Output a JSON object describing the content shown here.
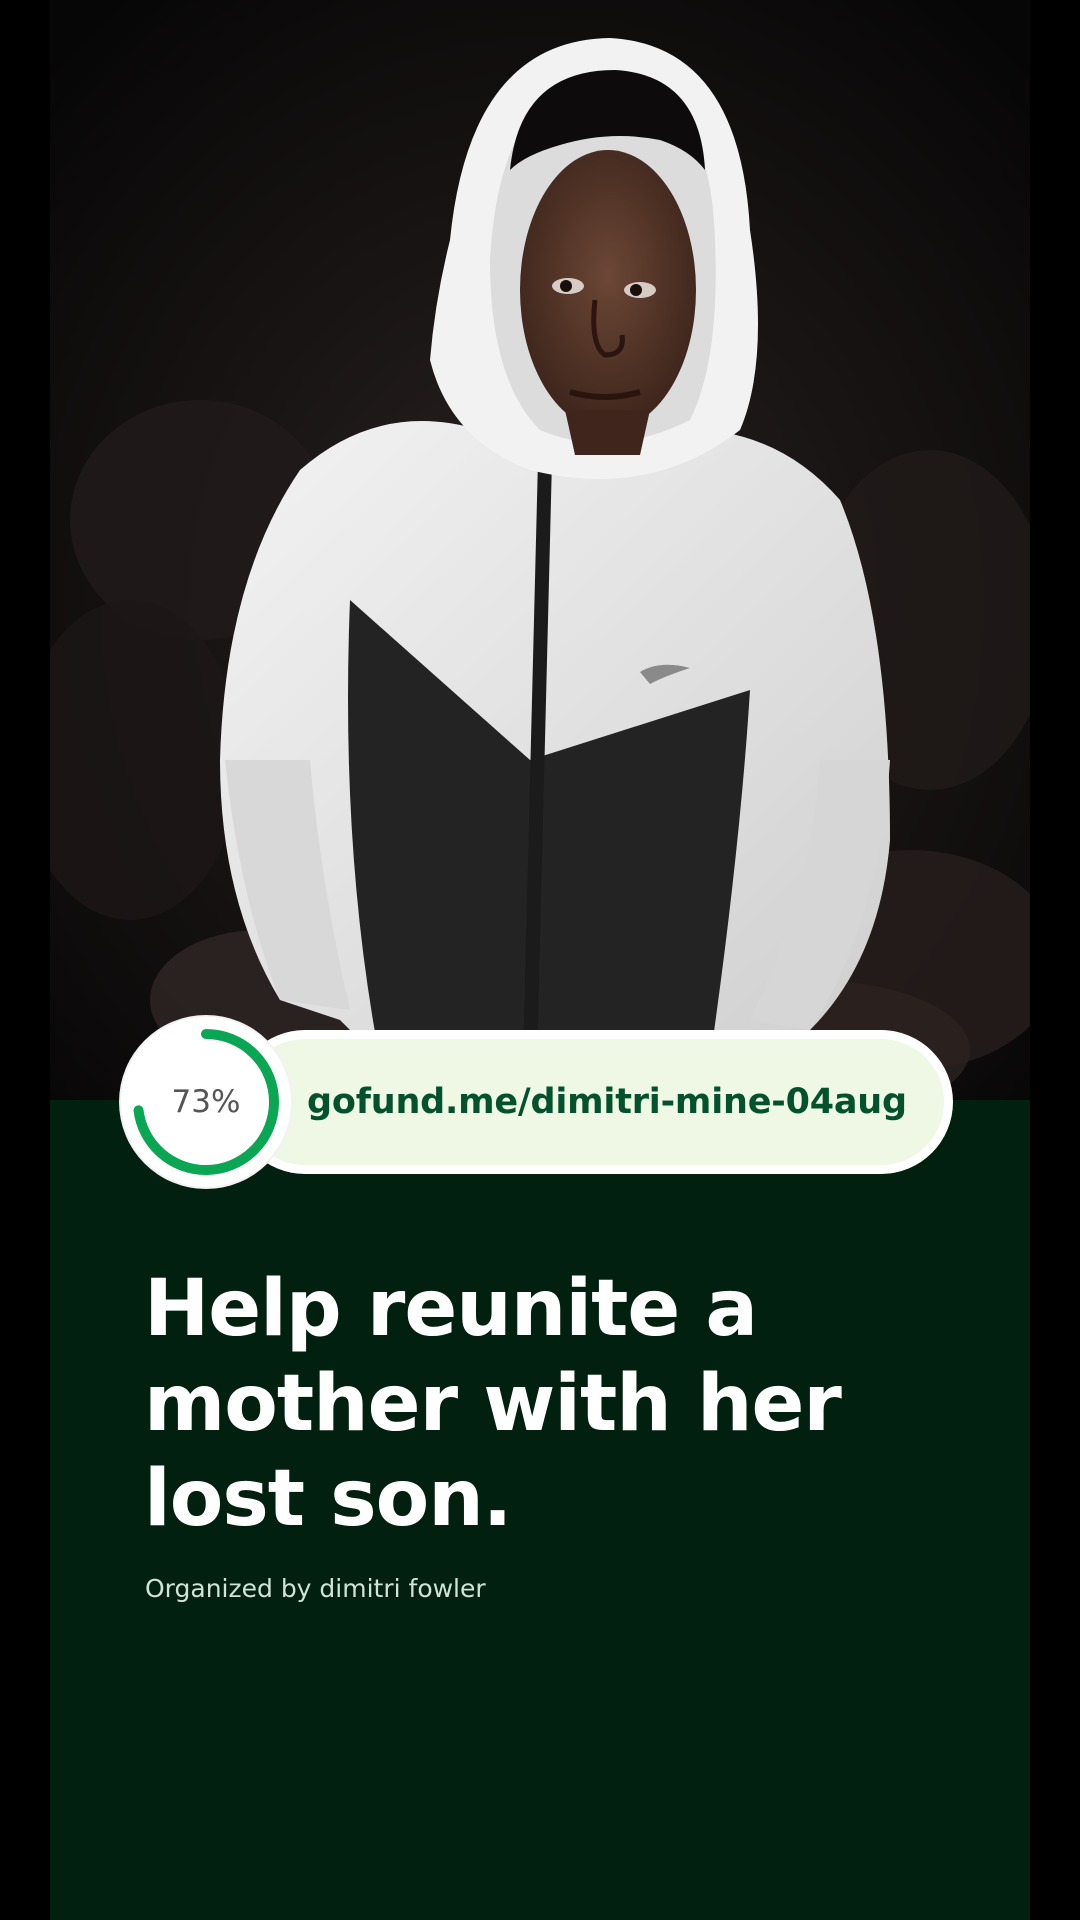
{
  "campaign": {
    "progress_label": "73%",
    "progress_value": 0.73,
    "url": "gofund.me/dimitri-mine-04aug",
    "title": "Help reunite a mother with her lost son.",
    "organizer_text": "Organized by dimitri fowler"
  },
  "colors": {
    "background": "#02200f",
    "accent_green": "#0aa654",
    "url_text": "#04522d",
    "url_bar_fill": "#eef8e4"
  },
  "icons": {
    "progress": "progress-ring-icon"
  }
}
